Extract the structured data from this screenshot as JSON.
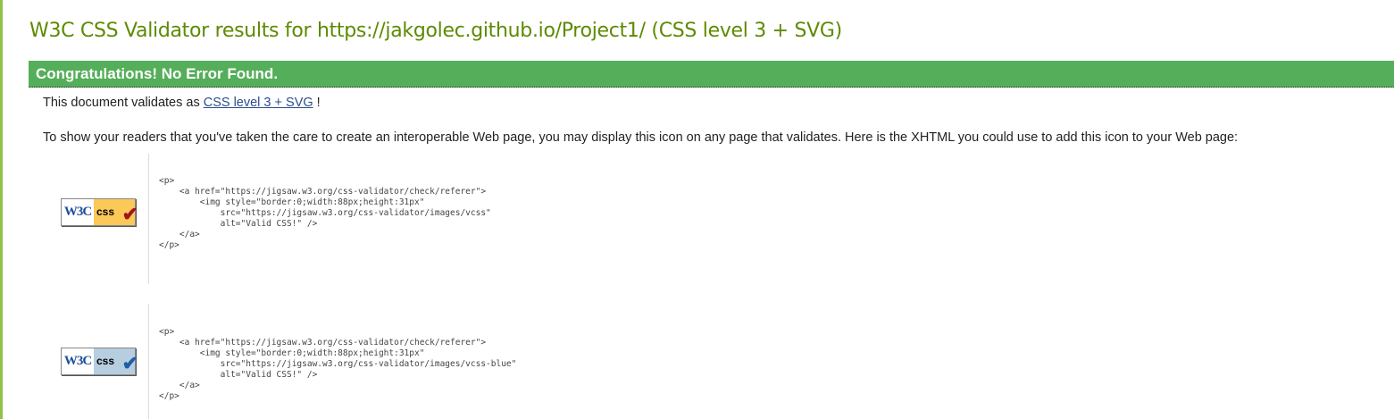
{
  "title": "W3C CSS Validator results for https://jakgolec.github.io/Project1/ (CSS level 3 + SVG)",
  "banner": "Congratulations! No Error Found.",
  "validates": {
    "prefix": "This document validates as ",
    "link": "CSS level 3 + SVG",
    "suffix": " !"
  },
  "intro": "To show your readers that you've taken the care to create an interoperable Web page, you may display this icon on any page that validates. Here is the XHTML you could use to add this icon to your Web page:",
  "badges": [
    {
      "w3c": "W3C",
      "css": "css",
      "bg": "#fcc858",
      "check": "#a0141a",
      "icon": "valid-css-gold-badge",
      "code": "<p>\n    <a href=\"https://jigsaw.w3.org/css-validator/check/referer\">\n        <img style=\"border:0;width:88px;height:31px\"\n            src=\"https://jigsaw.w3.org/css-validator/images/vcss\"\n            alt=\"Valid CSS!\" />\n    </a>\n</p>"
    },
    {
      "w3c": "W3C",
      "css": "css",
      "bg": "#b7cde0",
      "check": "#1d5fa5",
      "icon": "valid-css-blue-badge",
      "code": "<p>\n    <a href=\"https://jigsaw.w3.org/css-validator/check/referer\">\n        <img style=\"border:0;width:88px;height:31px\"\n            src=\"https://jigsaw.w3.org/css-validator/images/vcss-blue\"\n            alt=\"Valid CSS!\" />\n    </a>\n</p>"
    }
  ]
}
